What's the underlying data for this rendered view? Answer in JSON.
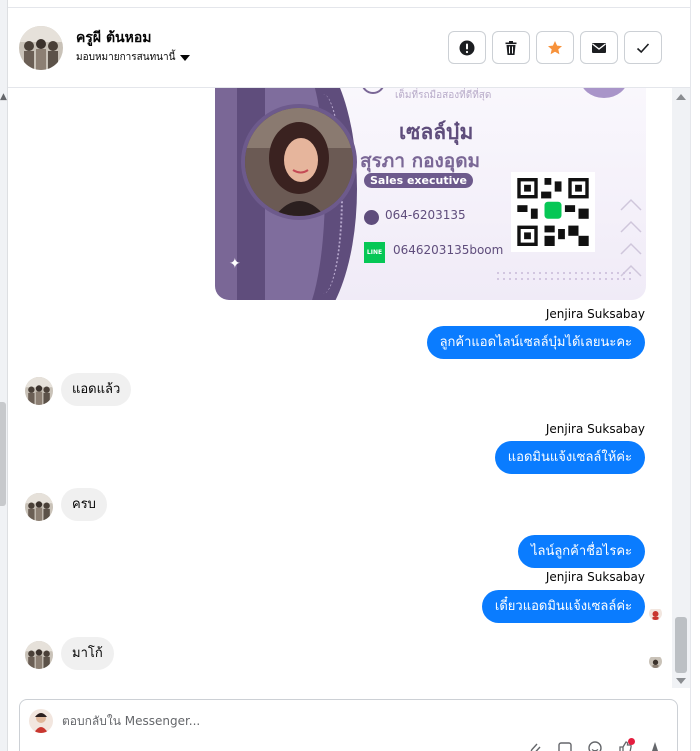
{
  "header": {
    "contact_name": "ครูผี ต้นหอม",
    "assign_label": "มอบหมายการสนทนานี้",
    "actions": [
      {
        "icon": "alert-icon",
        "name": "mark-spam-button"
      },
      {
        "icon": "trash-icon",
        "name": "delete-button"
      },
      {
        "icon": "star-icon",
        "name": "star-button"
      },
      {
        "icon": "mail-icon",
        "name": "mark-unread-button"
      },
      {
        "icon": "check-icon",
        "name": "mark-done-button"
      }
    ]
  },
  "card": {
    "title": "เซลล์บุ๋ม",
    "person": "สุรภา   กองอุดม",
    "position": "Sales executive",
    "phone": "064-6203135",
    "line_badge": "LINE",
    "line_id": "0646203135boom",
    "top_text": "เต็มที่รถมือสองที่ดีที่สุด"
  },
  "messages": {
    "m1_sender": "Jenjira Suksabay",
    "m1_text": "ลูกค้าแอดไลน์เซลล์บุ๋มได้เลยนะคะ",
    "m2_text": "แอดแล้ว",
    "m3_sender": "Jenjira Suksabay",
    "m3_text": "แอดมินแจ้งเซลล์ให้ค่ะ",
    "m4_text": "ครบ",
    "m5_text": "ไลน์ลูกค้าชื่อไรคะ",
    "m6_sender": "Jenjira Suksabay",
    "m6_text": "เดี๋ยวแอดมินแจ้งเซลล์ค่ะ",
    "m7_text": "มาโก้"
  },
  "composer": {
    "placeholder": "ตอบกลับใน Messenger..."
  },
  "colors": {
    "outgoing_bubble": "#0a7cff",
    "incoming_bubble": "#f0f0f0",
    "star": "#f7923b",
    "card_purple": "#6d5a8c"
  }
}
